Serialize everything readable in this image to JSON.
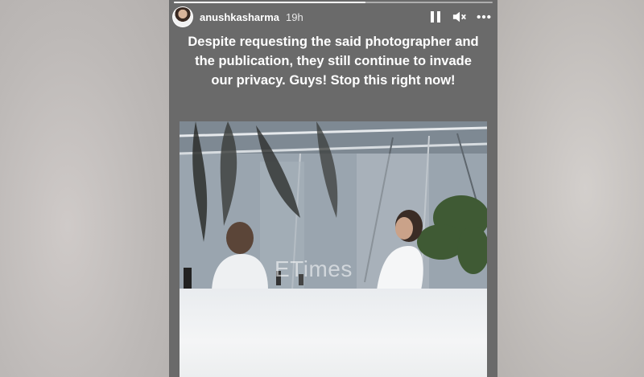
{
  "story": {
    "username": "anushkasharma",
    "time": "19h",
    "caption": "Despite requesting the said photographer and the publication, they still continue to invade our privacy. Guys! Stop this right now!",
    "photo_watermark": "ETimes",
    "progress": 0.6
  },
  "controls": {
    "pause_icon": "pause-icon",
    "mute_icon": "mute-icon",
    "more_icon": "more-icon"
  },
  "colors": {
    "story_bg": "#6a6a6a",
    "text": "#ffffff"
  }
}
